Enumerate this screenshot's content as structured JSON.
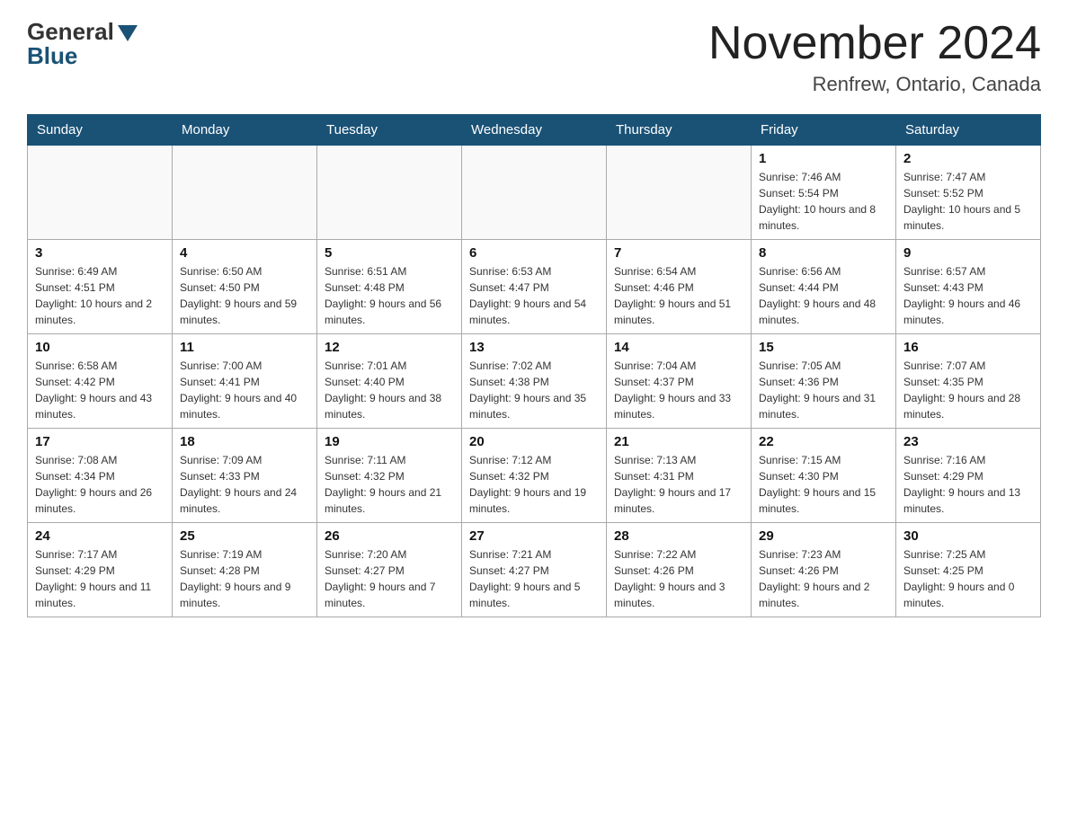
{
  "header": {
    "logo_general": "General",
    "logo_blue": "Blue",
    "month_title": "November 2024",
    "location": "Renfrew, Ontario, Canada"
  },
  "weekdays": [
    "Sunday",
    "Monday",
    "Tuesday",
    "Wednesday",
    "Thursday",
    "Friday",
    "Saturday"
  ],
  "weeks": [
    [
      {
        "day": "",
        "info": ""
      },
      {
        "day": "",
        "info": ""
      },
      {
        "day": "",
        "info": ""
      },
      {
        "day": "",
        "info": ""
      },
      {
        "day": "",
        "info": ""
      },
      {
        "day": "1",
        "info": "Sunrise: 7:46 AM\nSunset: 5:54 PM\nDaylight: 10 hours and 8 minutes."
      },
      {
        "day": "2",
        "info": "Sunrise: 7:47 AM\nSunset: 5:52 PM\nDaylight: 10 hours and 5 minutes."
      }
    ],
    [
      {
        "day": "3",
        "info": "Sunrise: 6:49 AM\nSunset: 4:51 PM\nDaylight: 10 hours and 2 minutes."
      },
      {
        "day": "4",
        "info": "Sunrise: 6:50 AM\nSunset: 4:50 PM\nDaylight: 9 hours and 59 minutes."
      },
      {
        "day": "5",
        "info": "Sunrise: 6:51 AM\nSunset: 4:48 PM\nDaylight: 9 hours and 56 minutes."
      },
      {
        "day": "6",
        "info": "Sunrise: 6:53 AM\nSunset: 4:47 PM\nDaylight: 9 hours and 54 minutes."
      },
      {
        "day": "7",
        "info": "Sunrise: 6:54 AM\nSunset: 4:46 PM\nDaylight: 9 hours and 51 minutes."
      },
      {
        "day": "8",
        "info": "Sunrise: 6:56 AM\nSunset: 4:44 PM\nDaylight: 9 hours and 48 minutes."
      },
      {
        "day": "9",
        "info": "Sunrise: 6:57 AM\nSunset: 4:43 PM\nDaylight: 9 hours and 46 minutes."
      }
    ],
    [
      {
        "day": "10",
        "info": "Sunrise: 6:58 AM\nSunset: 4:42 PM\nDaylight: 9 hours and 43 minutes."
      },
      {
        "day": "11",
        "info": "Sunrise: 7:00 AM\nSunset: 4:41 PM\nDaylight: 9 hours and 40 minutes."
      },
      {
        "day": "12",
        "info": "Sunrise: 7:01 AM\nSunset: 4:40 PM\nDaylight: 9 hours and 38 minutes."
      },
      {
        "day": "13",
        "info": "Sunrise: 7:02 AM\nSunset: 4:38 PM\nDaylight: 9 hours and 35 minutes."
      },
      {
        "day": "14",
        "info": "Sunrise: 7:04 AM\nSunset: 4:37 PM\nDaylight: 9 hours and 33 minutes."
      },
      {
        "day": "15",
        "info": "Sunrise: 7:05 AM\nSunset: 4:36 PM\nDaylight: 9 hours and 31 minutes."
      },
      {
        "day": "16",
        "info": "Sunrise: 7:07 AM\nSunset: 4:35 PM\nDaylight: 9 hours and 28 minutes."
      }
    ],
    [
      {
        "day": "17",
        "info": "Sunrise: 7:08 AM\nSunset: 4:34 PM\nDaylight: 9 hours and 26 minutes."
      },
      {
        "day": "18",
        "info": "Sunrise: 7:09 AM\nSunset: 4:33 PM\nDaylight: 9 hours and 24 minutes."
      },
      {
        "day": "19",
        "info": "Sunrise: 7:11 AM\nSunset: 4:32 PM\nDaylight: 9 hours and 21 minutes."
      },
      {
        "day": "20",
        "info": "Sunrise: 7:12 AM\nSunset: 4:32 PM\nDaylight: 9 hours and 19 minutes."
      },
      {
        "day": "21",
        "info": "Sunrise: 7:13 AM\nSunset: 4:31 PM\nDaylight: 9 hours and 17 minutes."
      },
      {
        "day": "22",
        "info": "Sunrise: 7:15 AM\nSunset: 4:30 PM\nDaylight: 9 hours and 15 minutes."
      },
      {
        "day": "23",
        "info": "Sunrise: 7:16 AM\nSunset: 4:29 PM\nDaylight: 9 hours and 13 minutes."
      }
    ],
    [
      {
        "day": "24",
        "info": "Sunrise: 7:17 AM\nSunset: 4:29 PM\nDaylight: 9 hours and 11 minutes."
      },
      {
        "day": "25",
        "info": "Sunrise: 7:19 AM\nSunset: 4:28 PM\nDaylight: 9 hours and 9 minutes."
      },
      {
        "day": "26",
        "info": "Sunrise: 7:20 AM\nSunset: 4:27 PM\nDaylight: 9 hours and 7 minutes."
      },
      {
        "day": "27",
        "info": "Sunrise: 7:21 AM\nSunset: 4:27 PM\nDaylight: 9 hours and 5 minutes."
      },
      {
        "day": "28",
        "info": "Sunrise: 7:22 AM\nSunset: 4:26 PM\nDaylight: 9 hours and 3 minutes."
      },
      {
        "day": "29",
        "info": "Sunrise: 7:23 AM\nSunset: 4:26 PM\nDaylight: 9 hours and 2 minutes."
      },
      {
        "day": "30",
        "info": "Sunrise: 7:25 AM\nSunset: 4:25 PM\nDaylight: 9 hours and 0 minutes."
      }
    ]
  ]
}
